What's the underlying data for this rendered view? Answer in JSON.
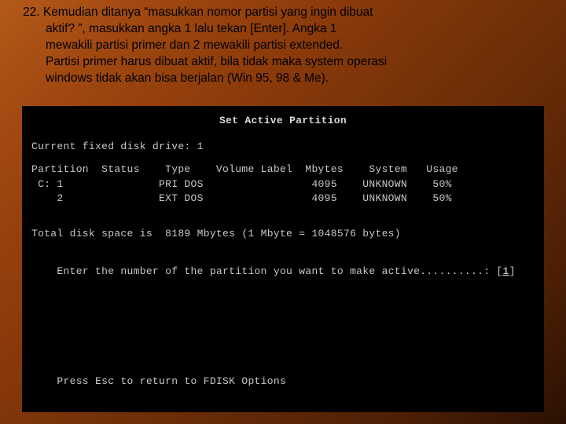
{
  "slide": {
    "number": "22.",
    "line1": "22. Kemudian ditanya “masukkan nomor partisi yang ingin dibuat",
    "line2": "aktif? ”, masukkan angka 1 lalu tekan [Enter]. Angka 1",
    "line3": "mewakili partisi primer dan 2 mewakili partisi extended.",
    "line4": "Partisi primer harus dibuat aktif, bila tidak maka system operasi",
    "line5": "windows tidak akan bisa berjalan (Win 95, 98 & Me)."
  },
  "terminal": {
    "title": "Set Active Partition",
    "current_disk": "Current fixed disk drive: 1",
    "header": "Partition  Status    Type    Volume Label  Mbytes    System   Usage",
    "row1": " C: 1               PRI DOS                 4095    UNKNOWN    50%",
    "row2": "    2               EXT DOS                 4095    UNKNOWN    50%",
    "total": "Total disk space is  8189 Mbytes (1 Mbyte = 1048576 bytes)",
    "prompt_pre": "Enter the number of the partition you want to make active..........: [",
    "prompt_val": "1",
    "prompt_post": "]",
    "footer_pre": "Press ",
    "footer_key": "Esc",
    "footer_post": " to return to FDISK Options"
  }
}
